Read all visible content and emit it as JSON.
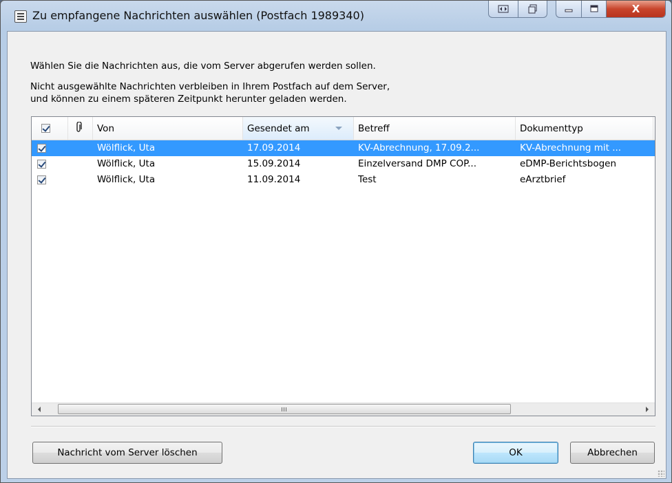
{
  "window": {
    "title": "Zu empfangene Nachrichten auswählen  (Postfach 1989340)",
    "icon": "app-window-icon",
    "title_buttons": [
      "nav-arrows-icon",
      "restore-view-icon",
      "minimize-icon",
      "maximize-icon",
      "close-icon"
    ],
    "close_label": "X"
  },
  "description": {
    "line1": "Wählen Sie die Nachrichten aus, die vom Server abgerufen werden sollen.",
    "line2": "Nicht ausgewählte Nachrichten verbleiben in Ihrem Postfach auf dem Server,",
    "line3": "und können zu einem späteren Zeitpunkt herunter geladen werden."
  },
  "list": {
    "header_checkbox_checked": true,
    "columns": {
      "attachment_icon": "paperclip-icon",
      "von": "Von",
      "gesendet": "Gesendet am",
      "betreff": "Betreff",
      "dokumenttyp": "Dokumenttyp"
    },
    "sorted_column": "Gesendet am",
    "sort_direction": "descending",
    "rows": [
      {
        "checked": true,
        "selected": true,
        "von": "Wölflick, Uta",
        "gesendet": "17.09.2014",
        "betreff": "KV-Abrechnung, 17.09.2...",
        "dokumenttyp": "KV-Abrechnung mit ..."
      },
      {
        "checked": true,
        "selected": false,
        "von": "Wölflick, Uta",
        "gesendet": "15.09.2014",
        "betreff": "Einzelversand DMP COP...",
        "dokumenttyp": "eDMP-Berichtsbogen"
      },
      {
        "checked": true,
        "selected": false,
        "von": "Wölflick, Uta",
        "gesendet": "11.09.2014",
        "betreff": "Test",
        "dokumenttyp": "eArztbrief"
      }
    ]
  },
  "buttons": {
    "delete": "Nachricht vom Server löschen",
    "ok": "OK",
    "cancel": "Abbrechen"
  },
  "colors": {
    "selection": "#3399ff",
    "close_button": "#c8452c"
  }
}
